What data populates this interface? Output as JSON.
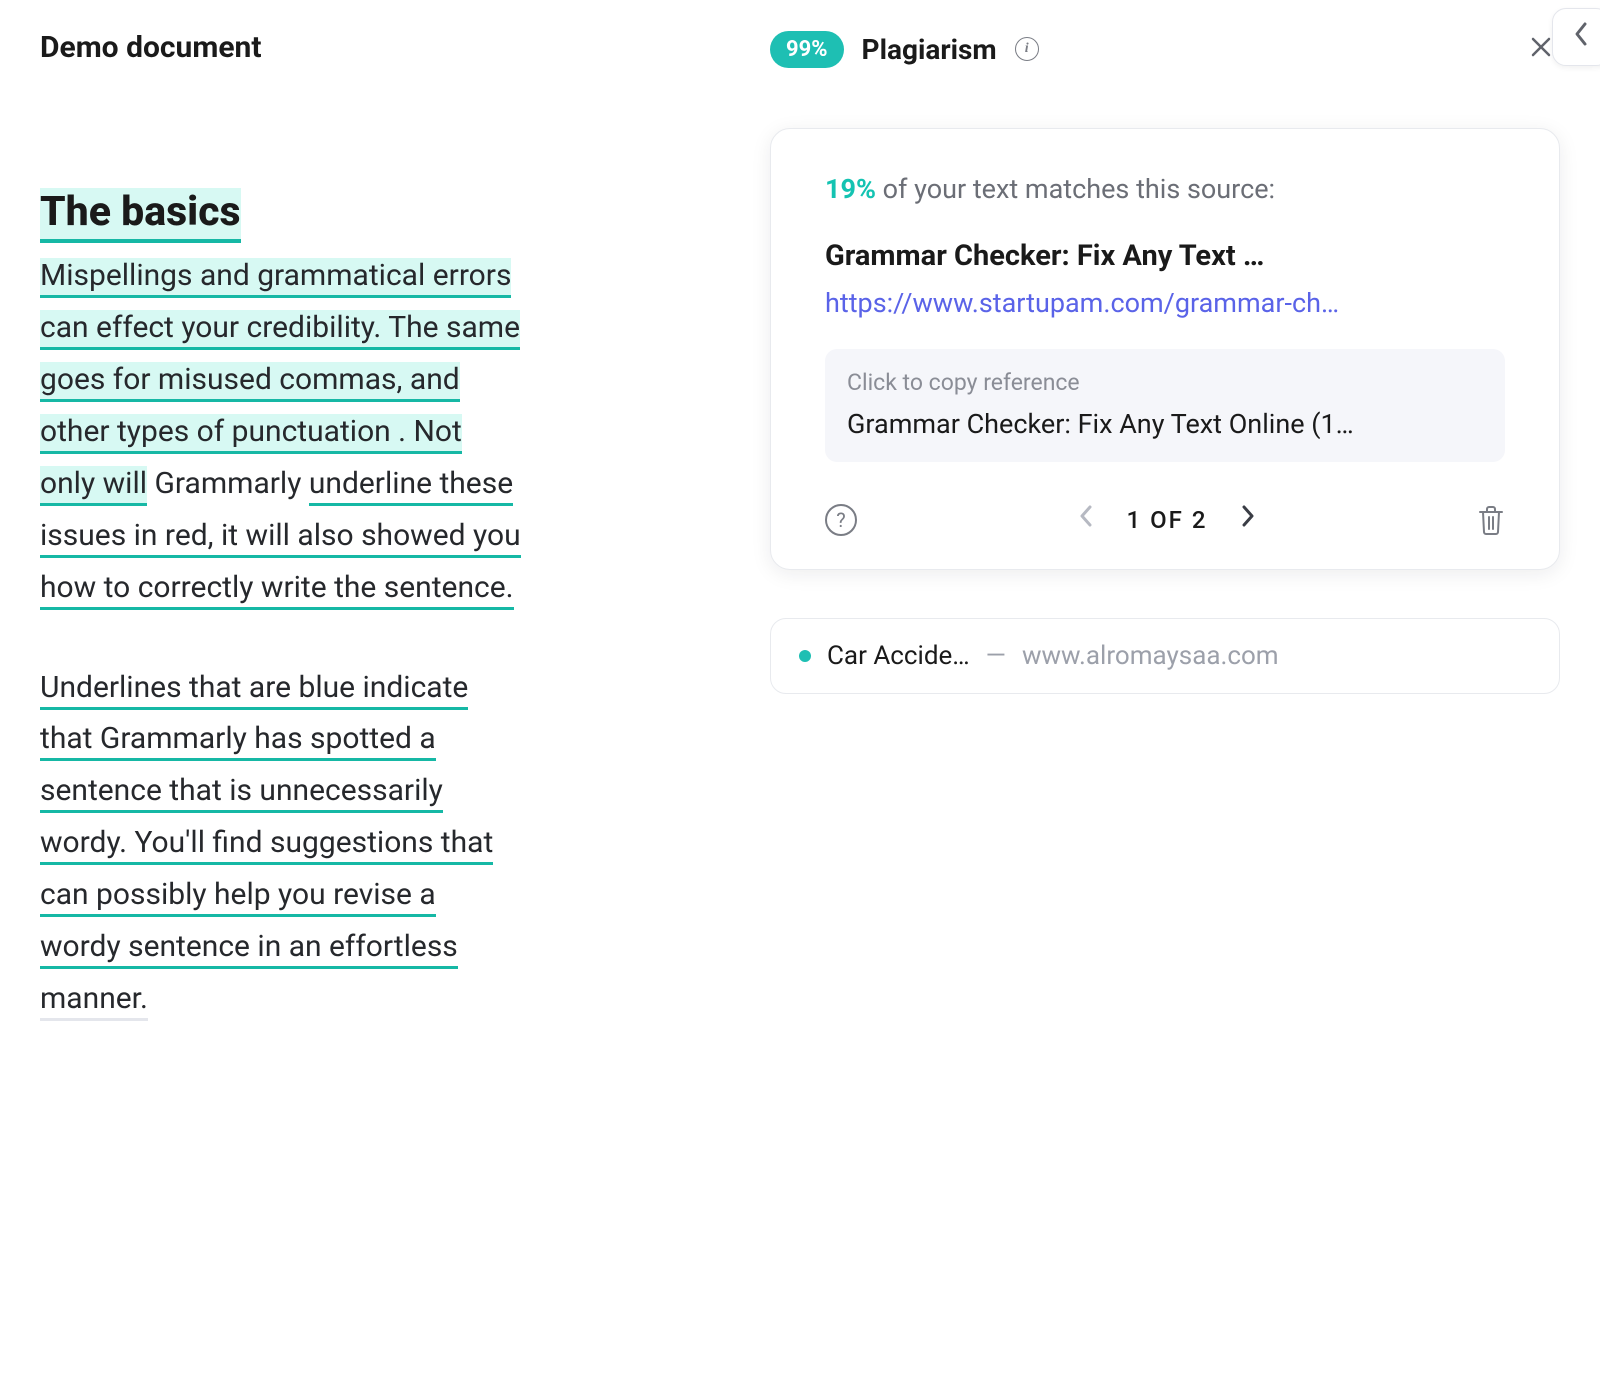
{
  "document": {
    "title": "Demo document",
    "heading": "The basics",
    "para1_parts": {
      "p1": "Mispellings and grammatical errors ",
      "p2": "can effect your credibility. The same ",
      "p3": "goes for misused commas, and ",
      "p4": "other types of punctuation . Not ",
      "p5": "only will",
      "gap1": " Grammarly ",
      "p6": "underline these ",
      "p7": "issues in red, it will also showed ",
      "p8": "you ",
      "p9": "how to correctly write the sentence."
    },
    "para2_parts": {
      "p1": "Underlines that are blue indicate ",
      "p2": "that Grammarly has spotted a ",
      "p3": "sentence that is unnecessarily ",
      "p4": "wordy. You'll find suggestions that ",
      "p5": "can possibly help you revise a ",
      "p6": "wordy sentence in an effortless ",
      "p7": "manner."
    }
  },
  "plagiarism": {
    "score_badge": "99%",
    "title": "Plagiarism",
    "pager_label": "1 OF 2"
  },
  "source_card": {
    "match_percent": "19%",
    "match_rest": " of your text matches this source:",
    "title": "Grammar Checker: Fix Any Text …",
    "url": "https://www.startupam.com/grammar-ch…",
    "ref_label": "Click to copy reference",
    "ref_text": "Grammar Checker: Fix Any Text Online (1…"
  },
  "other_source": {
    "title": "Car Accide…",
    "domain": "www.alromaysaa.com"
  }
}
